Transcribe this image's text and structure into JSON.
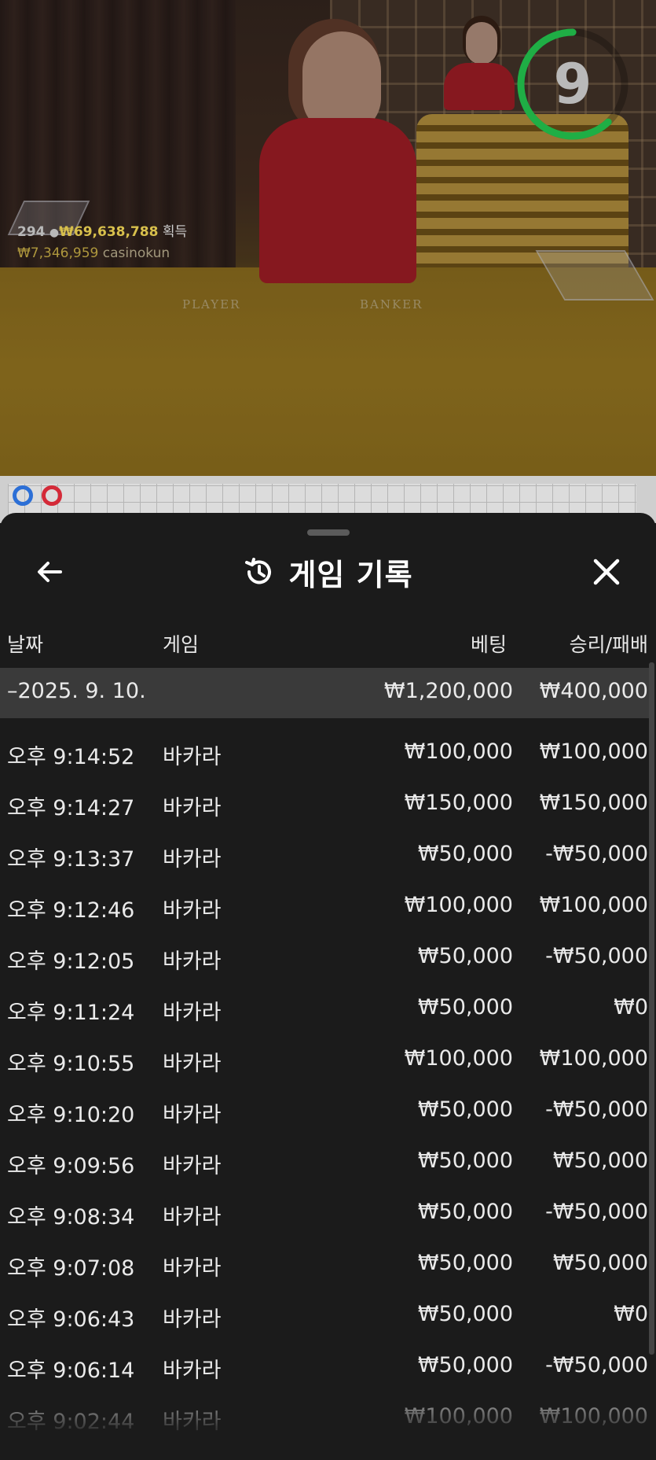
{
  "video": {
    "timer_value": "9",
    "timer_fraction": 0.62,
    "winner_count": "294",
    "winner_total": "₩69,638,788",
    "winner_suffix": "획득",
    "last_win_amount": "₩7,346,959",
    "last_win_user": "casinokun",
    "felt_player": "PLAYER",
    "felt_banker": "BANKER"
  },
  "road": {
    "circles": [
      "blue",
      "red"
    ]
  },
  "sheet": {
    "title": "게임 기록",
    "icons": {
      "back": "arrow-left-icon",
      "history": "history-icon",
      "close": "close-icon"
    },
    "columns": {
      "date": "날짜",
      "game": "게임",
      "bet": "베팅",
      "result": "승리/패배"
    },
    "summary": {
      "date": "–2025. 9. 10.",
      "bet": "₩1,200,000",
      "result": "₩400,000"
    },
    "rows": [
      {
        "time": "오후 9:14:52",
        "game": "바카라",
        "bet": "₩100,000",
        "result": "₩100,000"
      },
      {
        "time": "오후 9:14:27",
        "game": "바카라",
        "bet": "₩150,000",
        "result": "₩150,000"
      },
      {
        "time": "오후 9:13:37",
        "game": "바카라",
        "bet": "₩50,000",
        "result": "-₩50,000"
      },
      {
        "time": "오후 9:12:46",
        "game": "바카라",
        "bet": "₩100,000",
        "result": "₩100,000"
      },
      {
        "time": "오후 9:12:05",
        "game": "바카라",
        "bet": "₩50,000",
        "result": "-₩50,000"
      },
      {
        "time": "오후 9:11:24",
        "game": "바카라",
        "bet": "₩50,000",
        "result": "₩0"
      },
      {
        "time": "오후 9:10:55",
        "game": "바카라",
        "bet": "₩100,000",
        "result": "₩100,000"
      },
      {
        "time": "오후 9:10:20",
        "game": "바카라",
        "bet": "₩50,000",
        "result": "-₩50,000"
      },
      {
        "time": "오후 9:09:56",
        "game": "바카라",
        "bet": "₩50,000",
        "result": "₩50,000"
      },
      {
        "time": "오후 9:08:34",
        "game": "바카라",
        "bet": "₩50,000",
        "result": "-₩50,000"
      },
      {
        "time": "오후 9:07:08",
        "game": "바카라",
        "bet": "₩50,000",
        "result": "₩50,000"
      },
      {
        "time": "오후 9:06:43",
        "game": "바카라",
        "bet": "₩50,000",
        "result": "₩0"
      },
      {
        "time": "오후 9:06:14",
        "game": "바카라",
        "bet": "₩50,000",
        "result": "-₩50,000"
      },
      {
        "time": "오후 9:02:44",
        "game": "바카라",
        "bet": "₩100,000",
        "result": "₩100,000"
      }
    ]
  }
}
